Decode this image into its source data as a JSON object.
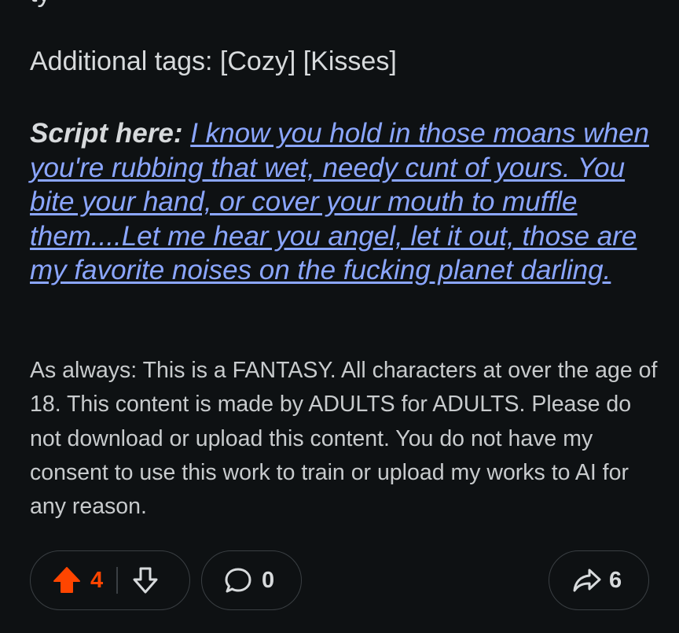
{
  "post": {
    "partial_line": "ty",
    "tags_line": "Additional tags: [Cozy] [Kisses]",
    "script_label": "Script here:",
    "script_link_text": "I know you hold in those moans when you're rubbing that wet, needy cunt of yours. You bite your hand, or cover your mouth to muffle them....Let me hear you angel, let it out, those are my favorite noises on the fucking planet darling.",
    "disclaimer": "As always: This is a FANTASY. All characters at over the age of 18. This content is made by ADULTS for ADULTS. Please do not download or upload this content. You do not have my consent to use this work to train or upload my works to AI for any reason."
  },
  "actions": {
    "upvote_count": "4",
    "comment_count": "0",
    "share_count": "6",
    "upvote_icon": "arrow-up-filled-icon",
    "downvote_icon": "arrow-down-outline-icon",
    "comment_icon": "speech-bubble-icon",
    "share_icon": "share-arrow-icon",
    "upvote_color": "#ff4500"
  },
  "colors": {
    "background": "#0e1113",
    "text": "#d7dadc",
    "link": "#8ba6ff",
    "border": "#3a3f43"
  }
}
